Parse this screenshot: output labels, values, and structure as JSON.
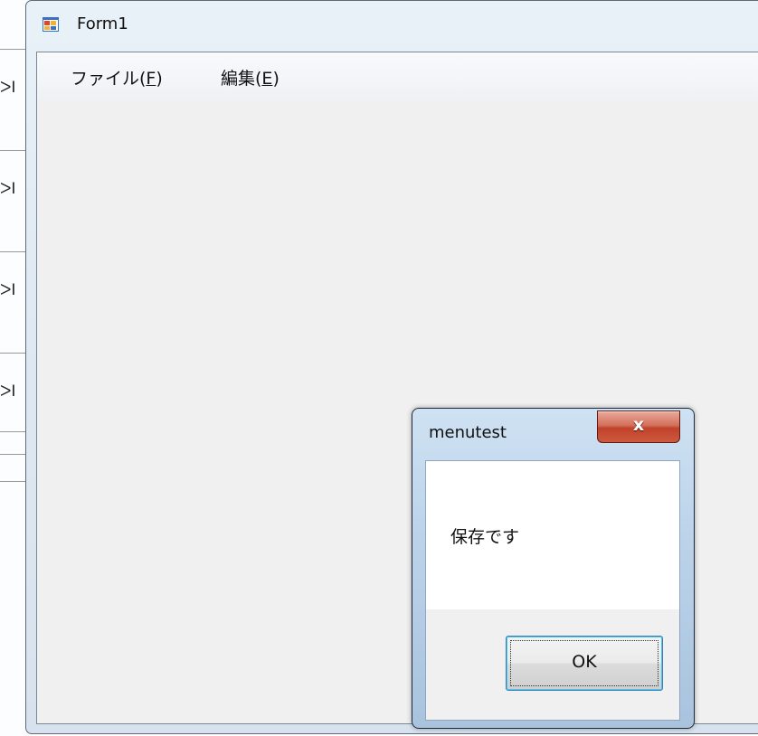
{
  "window": {
    "title": "Form1",
    "menus": [
      {
        "label": "ファイル(",
        "accel": "F",
        "suffix": ")"
      },
      {
        "label": "編集(",
        "accel": "E",
        "suffix": ")"
      }
    ]
  },
  "background_window": {
    "glyphs": [
      "ᐳI",
      "ᐳI",
      "ᐳI",
      "ᐳI"
    ]
  },
  "dialog": {
    "title": "menutest",
    "close_glyph": "x",
    "message": "保存です",
    "ok_label": "OK"
  },
  "colors": {
    "close_button": "#c0422a",
    "client_bg": "#f0f0f0",
    "focus_ring": "#48c6f7"
  }
}
